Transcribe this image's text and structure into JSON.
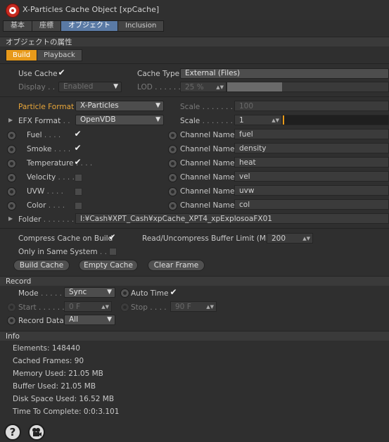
{
  "window": {
    "title": "X-Particles Cache Object [xpCache]"
  },
  "tabs": [
    "基本",
    "座標",
    "オブジェクト",
    "Inclusion"
  ],
  "object_props": {
    "header": "オブジェクトの属性",
    "subtabs": [
      "Build",
      "Playback"
    ],
    "use_cache_label": "Use Cache",
    "use_cache_checked": true,
    "cache_type_label": "Cache Type",
    "cache_type_value": "External (Files)",
    "display_label": "Display",
    "display_value": "Enabled",
    "lod_label": "LOD",
    "lod_value": "25 %",
    "particle_format_label": "Particle Format",
    "particle_format_value": "X-Particles",
    "scale_label": "Scale",
    "scale1_value": "100",
    "efx_format_label": "EFX Format",
    "efx_format_value": "OpenVDB",
    "scale2_value": "1",
    "channel_rows": [
      {
        "label": "Fuel",
        "checked": true,
        "channel_label": "Channel Name",
        "channel_value": "fuel"
      },
      {
        "label": "Smoke",
        "checked": true,
        "channel_label": "Channel Name",
        "channel_value": "density"
      },
      {
        "label": "Temperature",
        "checked": true,
        "channel_label": "Channel Name",
        "channel_value": "heat"
      },
      {
        "label": "Velocity",
        "checked": false,
        "channel_label": "Channel Name",
        "channel_value": "vel"
      },
      {
        "label": "UVW",
        "checked": false,
        "channel_label": "Channel Name",
        "channel_value": "uvw"
      },
      {
        "label": "Color",
        "checked": false,
        "channel_label": "Channel Name",
        "channel_value": "col"
      }
    ],
    "folder_label": "Folder",
    "folder_value": "I:¥Cash¥XPT_Cash¥xpCache_XPT4_xpExplosoaFX01",
    "compress_label": "Compress Cache on Build",
    "compress_checked": true,
    "buffer_label": "Read/Uncompress Buffer Limit (MB)",
    "buffer_value": "200",
    "same_system_label": "Only in Same System",
    "same_system_checked": false,
    "build_cache_btn": "Build Cache",
    "empty_cache_btn": "Empty Cache",
    "clear_frame_btn": "Clear Frame"
  },
  "record": {
    "header": "Record",
    "mode_label": "Mode",
    "mode_value": "Sync",
    "auto_time_label": "Auto Time",
    "auto_time_checked": true,
    "start_label": "Start",
    "start_value": "0 F",
    "stop_label": "Stop",
    "stop_value": "90 F",
    "record_data_label": "Record Data",
    "record_data_value": "All"
  },
  "info": {
    "header": "Info",
    "lines": [
      "Elements: 148440",
      "Cached Frames: 90",
      "Memory Used: 21.05 MB",
      "Buffer Used: 21.05 MB",
      "Disk Space Used: 16.52 MB",
      "Time To Complete: 0:0:3.101"
    ]
  },
  "colors": {
    "accent": "#e89a1a",
    "tab_active": "#5a7aa5",
    "bg": "#2f2f2f"
  },
  "icons": [
    "xparticles-logo-icon",
    "help-icon",
    "camera-icon"
  ]
}
